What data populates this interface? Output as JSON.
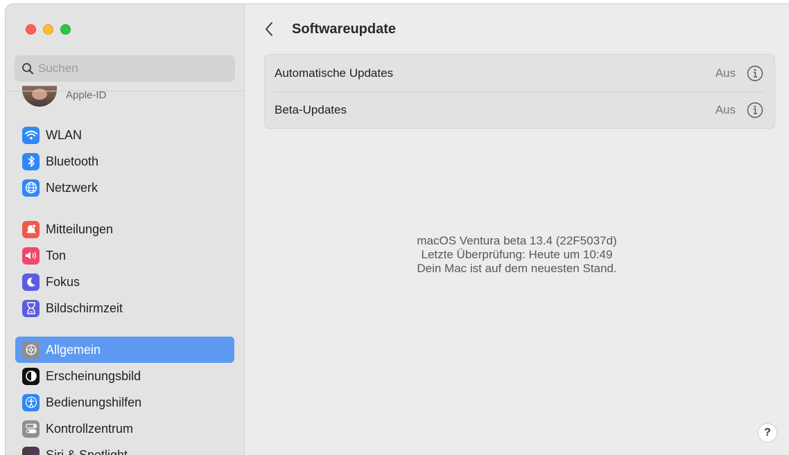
{
  "window": {
    "title": "Softwareupdate"
  },
  "sidebar": {
    "search_placeholder": "Suchen",
    "apple_id_label": "Apple-ID",
    "items": [
      {
        "label": "WLAN",
        "icon": "wifi-icon",
        "color": "#2f88f6"
      },
      {
        "label": "Bluetooth",
        "icon": "bluetooth-icon",
        "color": "#2f88f6"
      },
      {
        "label": "Netzwerk",
        "icon": "globe-icon",
        "color": "#2f88f6"
      },
      {
        "label": "Mitteilungen",
        "icon": "bell-icon",
        "color": "#f0584e"
      },
      {
        "label": "Ton",
        "icon": "speaker-icon",
        "color": "#f0476d"
      },
      {
        "label": "Fokus",
        "icon": "moon-icon",
        "color": "#5c5ce0"
      },
      {
        "label": "Bildschirmzeit",
        "icon": "hourglass-icon",
        "color": "#5c5ce0"
      },
      {
        "label": "Allgemein",
        "icon": "gear-icon",
        "color": "#8e8e93",
        "active": true
      },
      {
        "label": "Erscheinungsbild",
        "icon": "appearance-icon",
        "color": "#111111"
      },
      {
        "label": "Bedienungshilfen",
        "icon": "accessibility-icon",
        "color": "#2f88f6"
      },
      {
        "label": "Kontrollzentrum",
        "icon": "toggles-icon",
        "color": "#8e8e93"
      },
      {
        "label": "Siri & Spotlight",
        "icon": "siri-icon",
        "color": "#3a3a3a"
      }
    ]
  },
  "main": {
    "title": "Softwareupdate",
    "rows": [
      {
        "label": "Automatische Updates",
        "value": "Aus"
      },
      {
        "label": "Beta-Updates",
        "value": "Aus"
      }
    ],
    "status": {
      "os": "macOS Ventura beta 13.4 (22F5037d)",
      "last_check": "Letzte Überprüfung: Heute um 10:49",
      "message": "Dein Mac ist auf dem neuesten Stand."
    },
    "help_label": "?"
  },
  "colors": {
    "accent": "#5f9af2",
    "window_bg": "#ececec",
    "sidebar_bg": "#e3e3e3"
  }
}
